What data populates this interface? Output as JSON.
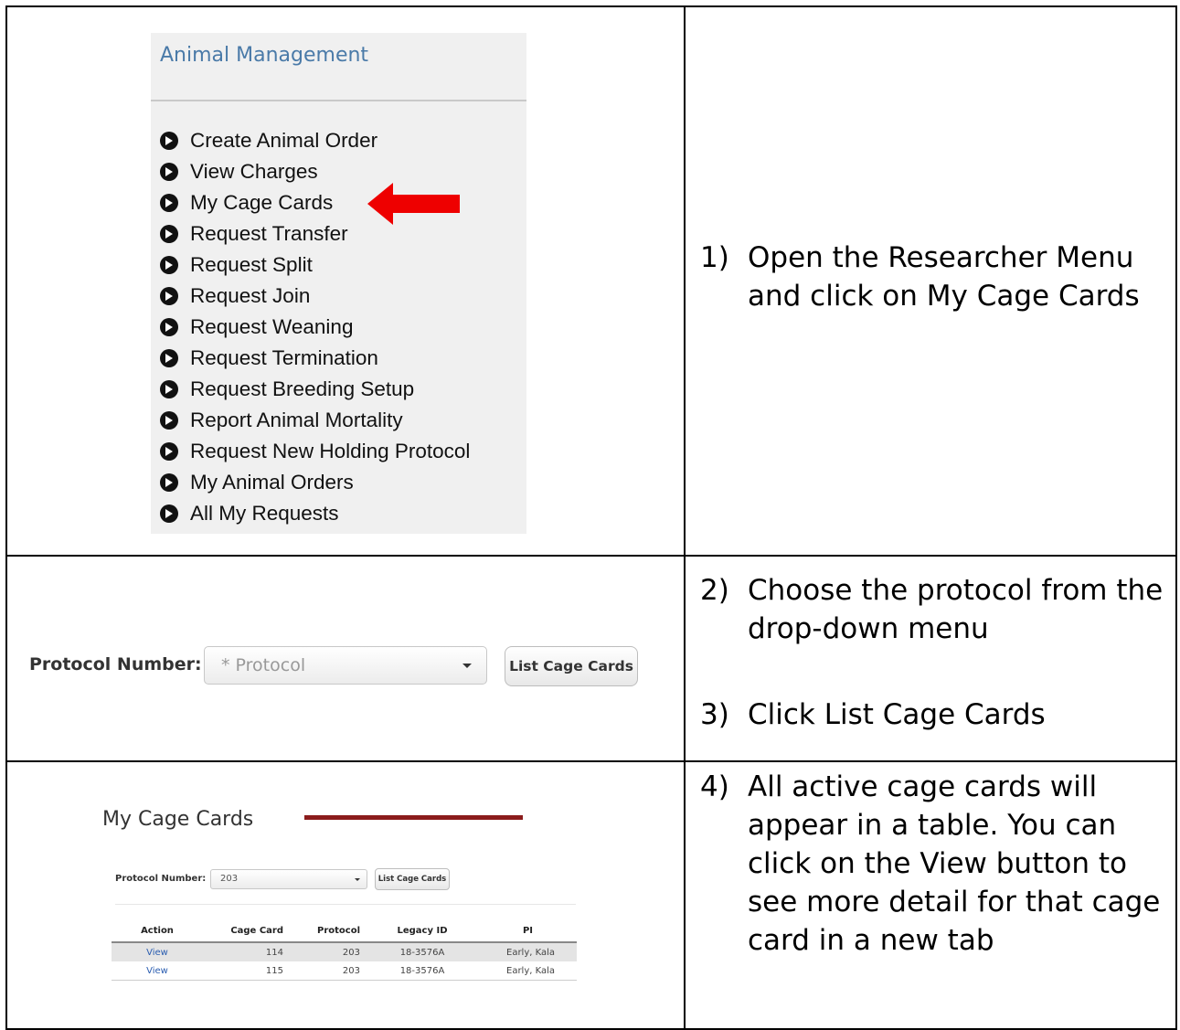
{
  "animal_management": {
    "title": "Animal Management",
    "items": [
      "Create Animal Order",
      "View Charges",
      "My Cage Cards",
      "Request Transfer",
      "Request Split",
      "Request Join",
      "Request Weaning",
      "Request Termination",
      "Request Breeding Setup",
      "Report Animal Mortality",
      "Request New Holding Protocol",
      "My Animal Orders",
      "All My Requests"
    ]
  },
  "steps": {
    "step1": {
      "num": "1)",
      "text": "Open the Researcher Menu and click on My Cage Cards"
    },
    "step2": {
      "num": "2)",
      "text": "Choose the protocol from the drop-down menu"
    },
    "step3": {
      "num": "3)",
      "text": "Click List Cage Cards"
    },
    "step4": {
      "num": "4)",
      "text": "All active cage cards will appear in a table. You can click on the View button to see more detail for that cage card in a new tab"
    }
  },
  "protocol_form": {
    "label": "Protocol Number:",
    "select_placeholder": "* Protocol",
    "button_label": "List Cage Cards"
  },
  "my_cage_cards": {
    "title": "My Cage Cards",
    "protocol_label": "Protocol Number:",
    "protocol_value": "203",
    "button_label": "List Cage Cards",
    "columns": [
      "Action",
      "Cage Card",
      "Protocol",
      "Legacy ID",
      "PI"
    ],
    "rows": [
      {
        "action": "View",
        "cage_card": "114",
        "protocol": "203",
        "legacy_id": "18-3576A",
        "pi": "Early, Kala"
      },
      {
        "action": "View",
        "cage_card": "115",
        "protocol": "203",
        "legacy_id": "18-3576A",
        "pi": "Early, Kala"
      }
    ]
  },
  "colors": {
    "arrow": "#ee0000",
    "menu_title": "#4a7aa8",
    "link": "#2a5db0",
    "banner": "#8b1c1c"
  }
}
